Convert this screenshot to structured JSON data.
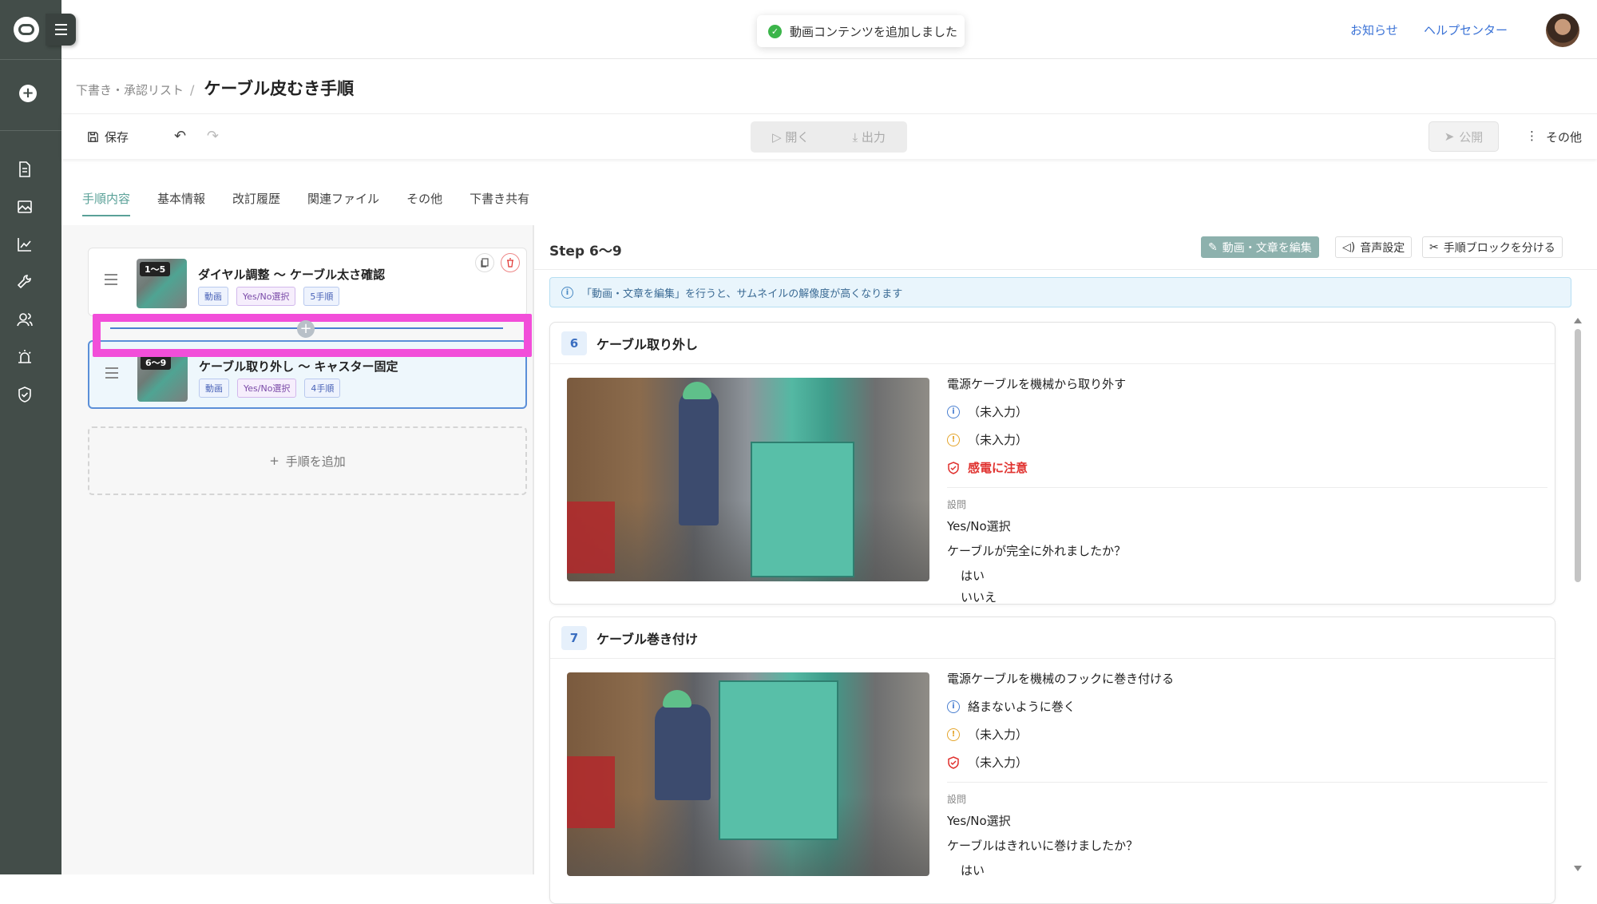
{
  "header": {
    "toast": "動画コンテンツを追加しました",
    "links": [
      "お知らせ",
      "ヘルプセンター"
    ]
  },
  "breadcrumb": {
    "parent": "下書き・承認リスト",
    "separator": "/",
    "title": "ケーブル皮むき手順"
  },
  "toolbar": {
    "save": "保存",
    "open": "開く",
    "export": "出力",
    "publish": "公開",
    "more": "その他"
  },
  "tabs": [
    "手順内容",
    "基本情報",
    "改訂履歴",
    "関連ファイル",
    "その他",
    "下書き共有"
  ],
  "blocks": [
    {
      "badge": "1～5",
      "title": "ダイヤル調整 〜 ケーブル太さ確認",
      "tags": [
        "動画",
        "Yes/No選択",
        "5手順"
      ]
    },
    {
      "badge": "6～9",
      "title": "ケーブル取り外し 〜 キャスター固定",
      "tags": [
        "動画",
        "Yes/No選択",
        "4手順"
      ]
    }
  ],
  "add_step": "手順を追加",
  "right": {
    "step_range": "Step 6～9",
    "edit_button": "動画・文章を編集",
    "audio_button": "音声設定",
    "split_button": "手順ブロックを分ける",
    "info": "「動画・文章を編集」を行うと、サムネイルの解像度が高くなります"
  },
  "steps": [
    {
      "number": "6",
      "title": "ケーブル取り外し",
      "main": "電源ケーブルを機械から取り外す",
      "info": "（未入力）",
      "warning": "（未入力）",
      "safety": "感電に注意",
      "q_label": "設問",
      "q_type": "Yes/No選択",
      "question": "ケーブルが完全に外れましたか？",
      "options": [
        "はい",
        "いいえ"
      ]
    },
    {
      "number": "7",
      "title": "ケーブル巻き付け",
      "main": "電源ケーブルを機械のフックに巻き付ける",
      "info": "絡まないように巻く",
      "warning": "（未入力）",
      "safety": "（未入力）",
      "q_label": "設問",
      "q_type": "Yes/No選択",
      "question": "ケーブルはきれいに巻けましたか？",
      "options": [
        "はい"
      ]
    }
  ],
  "colors": {
    "sidebar": "#434d49",
    "accent": "#5aa198",
    "link": "#3a72d6",
    "highlight": "#f24ed9",
    "danger": "#e0322f"
  }
}
